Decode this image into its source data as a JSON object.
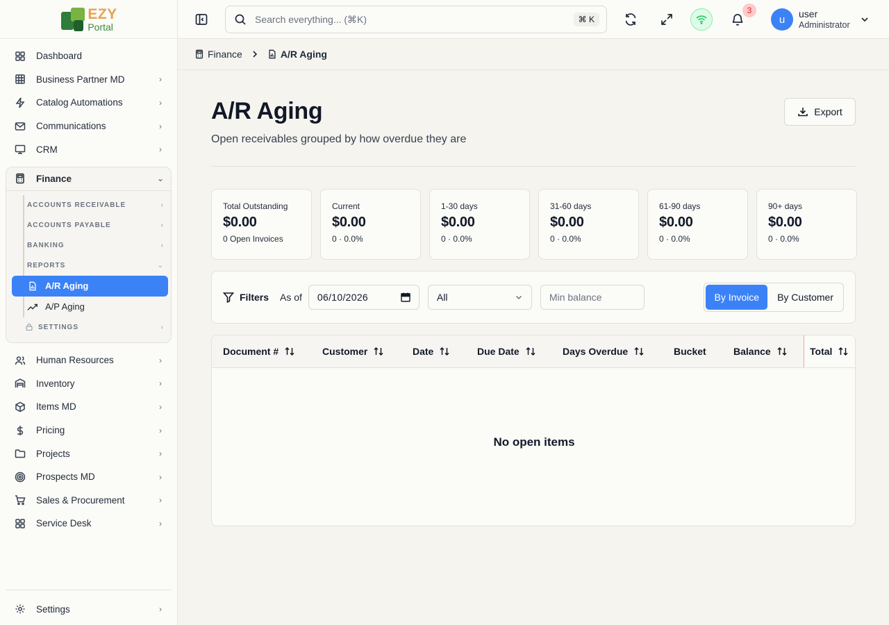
{
  "brand": {
    "line1": "EZY",
    "line2": "Portal"
  },
  "sidebar": {
    "items_top": [
      {
        "label": "Dashboard",
        "icon": "dashboard-icon"
      },
      {
        "label": "Business Partner MD",
        "icon": "building-icon"
      },
      {
        "label": "Catalog Automations",
        "icon": "zap-icon"
      },
      {
        "label": "Communications",
        "icon": "mail-icon"
      },
      {
        "label": "CRM",
        "icon": "monitor-icon"
      }
    ],
    "finance": {
      "label": "Finance",
      "sections": [
        "ACCOUNTS RECEIVABLE",
        "ACCOUNTS PAYABLE",
        "BANKING",
        "REPORTS"
      ],
      "reports": [
        {
          "label": "A/R Aging"
        },
        {
          "label": "A/P Aging"
        }
      ],
      "settings": "SETTINGS"
    },
    "items_bottom": [
      {
        "label": "Human Resources"
      },
      {
        "label": "Inventory"
      },
      {
        "label": "Items MD"
      },
      {
        "label": "Pricing"
      },
      {
        "label": "Projects"
      },
      {
        "label": "Prospects MD"
      },
      {
        "label": "Sales & Procurement"
      },
      {
        "label": "Service Desk"
      }
    ],
    "footer": {
      "label": "Settings"
    }
  },
  "topbar": {
    "search_placeholder": "Search everything... (⌘K)",
    "search_kbd": "⌘ K",
    "notifications_count": "3",
    "user": {
      "initial": "u",
      "name": "user",
      "role": "Administrator"
    }
  },
  "breadcrumb": {
    "parent": "Finance",
    "current": "A/R Aging"
  },
  "page": {
    "title": "A/R Aging",
    "subtitle": "Open receivables grouped by how overdue they are",
    "export_label": "Export"
  },
  "cards": [
    {
      "title": "Total Outstanding",
      "value": "$0.00",
      "sub": "0 Open Invoices"
    },
    {
      "title": "Current",
      "value": "$0.00",
      "sub": "0 · 0.0%"
    },
    {
      "title": "1-30 days",
      "value": "$0.00",
      "sub": "0 · 0.0%"
    },
    {
      "title": "31-60 days",
      "value": "$0.00",
      "sub": "0 · 0.0%"
    },
    {
      "title": "61-90 days",
      "value": "$0.00",
      "sub": "0 · 0.0%"
    },
    {
      "title": "90+ days",
      "value": "$0.00",
      "sub": "0 · 0.0%"
    }
  ],
  "filters": {
    "label": "Filters",
    "as_of_label": "As of",
    "date_value": "06/10/2026",
    "bucket_value": "All",
    "min_balance_placeholder": "Min balance",
    "view_by_invoice": "By Invoice",
    "view_by_customer": "By Customer"
  },
  "table": {
    "columns": [
      "Document #",
      "Customer",
      "Date",
      "Due Date",
      "Days Overdue",
      "Bucket",
      "Balance",
      "Total"
    ],
    "empty_text": "No open items"
  },
  "colors": {
    "accent": "#3b82f6",
    "online": "#22c55e",
    "badge": "#dc2626"
  }
}
